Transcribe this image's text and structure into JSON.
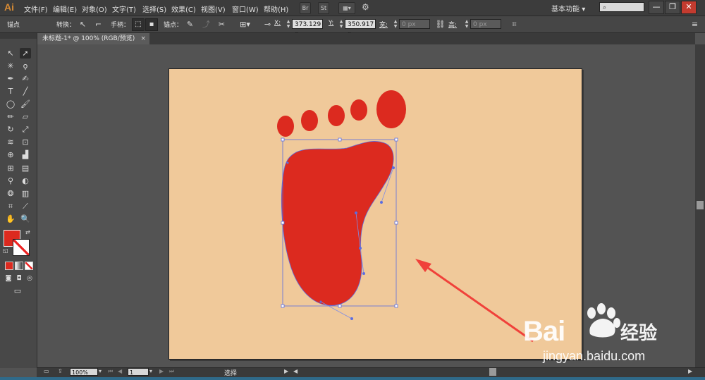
{
  "app": {
    "logo": "Ai"
  },
  "menu": [
    "文件(F)",
    "编辑(E)",
    "对象(O)",
    "文字(T)",
    "选择(S)",
    "效果(C)",
    "视图(V)",
    "窗口(W)",
    "帮助(H)"
  ],
  "menubar_buttons": {
    "br": "Br",
    "st": "St"
  },
  "workspace": {
    "label": "基本功能",
    "arrow": "▾"
  },
  "window_controls": {
    "minimize": "—",
    "restore": "❐",
    "close": "✕"
  },
  "control": {
    "anchor_label": "锚点",
    "convert_label": "转换：",
    "handles_label": "手柄：",
    "anchors_label": "锚点：",
    "x_label": "X:",
    "x_value": "373.129 p",
    "y_label": "Y:",
    "y_value": "350.917 p",
    "w_label": "宽:",
    "w_value": "0 px",
    "h_label": "高:",
    "h_value": "0 px"
  },
  "document": {
    "tab_title": "未标题-1* @ 100% (RGB/预览)",
    "close": "×"
  },
  "status": {
    "zoom": "100%",
    "page": "1",
    "tool_name": "选择"
  },
  "colors": {
    "fill": "#dc2a1f",
    "artboard": "#f0c99a",
    "selection": "#4a62e0",
    "arrow": "#f0413a"
  },
  "watermark": {
    "logo": "Bai",
    "suffix": "经验",
    "url": "jingyan.baidu.com"
  }
}
